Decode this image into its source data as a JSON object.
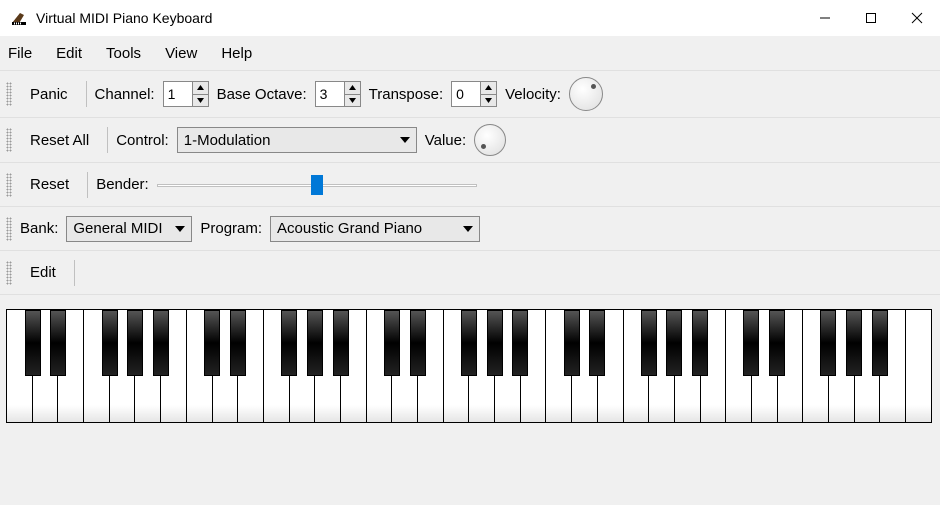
{
  "window": {
    "title": "Virtual MIDI Piano Keyboard"
  },
  "menu": {
    "file": "File",
    "edit": "Edit",
    "tools": "Tools",
    "view": "View",
    "help": "Help"
  },
  "row1": {
    "panic": "Panic",
    "channel_label": "Channel:",
    "channel_value": "1",
    "base_octave_label": "Base Octave:",
    "base_octave_value": "3",
    "transpose_label": "Transpose:",
    "transpose_value": "0",
    "velocity_label": "Velocity:"
  },
  "row2": {
    "reset_all": "Reset All",
    "control_label": "Control:",
    "control_value": "1-Modulation",
    "value_label": "Value:"
  },
  "row3": {
    "reset": "Reset",
    "bender_label": "Bender:",
    "bender_position": 0.5
  },
  "row4": {
    "bank_label": "Bank:",
    "bank_value": "General MIDI",
    "program_label": "Program:",
    "program_value": "Acoustic Grand Piano"
  },
  "row5": {
    "edit": "Edit"
  },
  "piano": {
    "white_key_count": 36,
    "black_key_pattern": [
      1,
      1,
      0,
      1,
      1,
      1,
      0
    ],
    "octaves_start_offset": 0
  }
}
